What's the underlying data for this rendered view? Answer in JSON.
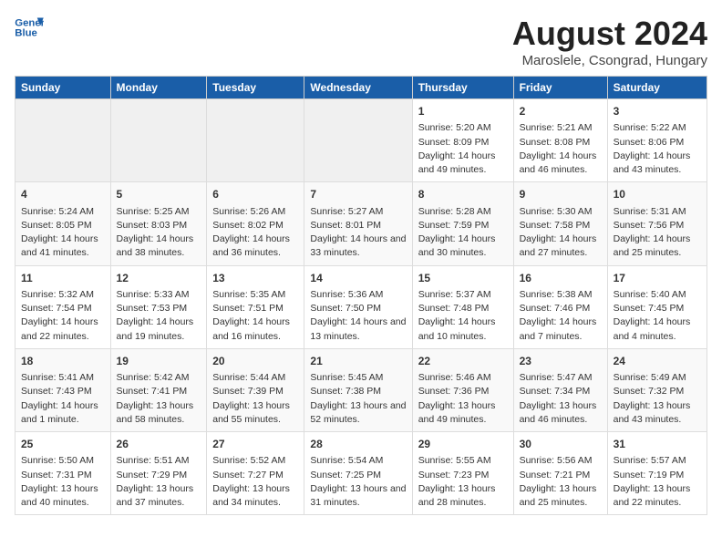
{
  "header": {
    "logo_line1": "General",
    "logo_line2": "Blue",
    "month_year": "August 2024",
    "location": "Maroslele, Csongrad, Hungary"
  },
  "days_of_week": [
    "Sunday",
    "Monday",
    "Tuesday",
    "Wednesday",
    "Thursday",
    "Friday",
    "Saturday"
  ],
  "weeks": [
    [
      {
        "day": "",
        "info": ""
      },
      {
        "day": "",
        "info": ""
      },
      {
        "day": "",
        "info": ""
      },
      {
        "day": "",
        "info": ""
      },
      {
        "day": "1",
        "info": "Sunrise: 5:20 AM\nSunset: 8:09 PM\nDaylight: 14 hours and 49 minutes."
      },
      {
        "day": "2",
        "info": "Sunrise: 5:21 AM\nSunset: 8:08 PM\nDaylight: 14 hours and 46 minutes."
      },
      {
        "day": "3",
        "info": "Sunrise: 5:22 AM\nSunset: 8:06 PM\nDaylight: 14 hours and 43 minutes."
      }
    ],
    [
      {
        "day": "4",
        "info": "Sunrise: 5:24 AM\nSunset: 8:05 PM\nDaylight: 14 hours and 41 minutes."
      },
      {
        "day": "5",
        "info": "Sunrise: 5:25 AM\nSunset: 8:03 PM\nDaylight: 14 hours and 38 minutes."
      },
      {
        "day": "6",
        "info": "Sunrise: 5:26 AM\nSunset: 8:02 PM\nDaylight: 14 hours and 36 minutes."
      },
      {
        "day": "7",
        "info": "Sunrise: 5:27 AM\nSunset: 8:01 PM\nDaylight: 14 hours and 33 minutes."
      },
      {
        "day": "8",
        "info": "Sunrise: 5:28 AM\nSunset: 7:59 PM\nDaylight: 14 hours and 30 minutes."
      },
      {
        "day": "9",
        "info": "Sunrise: 5:30 AM\nSunset: 7:58 PM\nDaylight: 14 hours and 27 minutes."
      },
      {
        "day": "10",
        "info": "Sunrise: 5:31 AM\nSunset: 7:56 PM\nDaylight: 14 hours and 25 minutes."
      }
    ],
    [
      {
        "day": "11",
        "info": "Sunrise: 5:32 AM\nSunset: 7:54 PM\nDaylight: 14 hours and 22 minutes."
      },
      {
        "day": "12",
        "info": "Sunrise: 5:33 AM\nSunset: 7:53 PM\nDaylight: 14 hours and 19 minutes."
      },
      {
        "day": "13",
        "info": "Sunrise: 5:35 AM\nSunset: 7:51 PM\nDaylight: 14 hours and 16 minutes."
      },
      {
        "day": "14",
        "info": "Sunrise: 5:36 AM\nSunset: 7:50 PM\nDaylight: 14 hours and 13 minutes."
      },
      {
        "day": "15",
        "info": "Sunrise: 5:37 AM\nSunset: 7:48 PM\nDaylight: 14 hours and 10 minutes."
      },
      {
        "day": "16",
        "info": "Sunrise: 5:38 AM\nSunset: 7:46 PM\nDaylight: 14 hours and 7 minutes."
      },
      {
        "day": "17",
        "info": "Sunrise: 5:40 AM\nSunset: 7:45 PM\nDaylight: 14 hours and 4 minutes."
      }
    ],
    [
      {
        "day": "18",
        "info": "Sunrise: 5:41 AM\nSunset: 7:43 PM\nDaylight: 14 hours and 1 minute."
      },
      {
        "day": "19",
        "info": "Sunrise: 5:42 AM\nSunset: 7:41 PM\nDaylight: 13 hours and 58 minutes."
      },
      {
        "day": "20",
        "info": "Sunrise: 5:44 AM\nSunset: 7:39 PM\nDaylight: 13 hours and 55 minutes."
      },
      {
        "day": "21",
        "info": "Sunrise: 5:45 AM\nSunset: 7:38 PM\nDaylight: 13 hours and 52 minutes."
      },
      {
        "day": "22",
        "info": "Sunrise: 5:46 AM\nSunset: 7:36 PM\nDaylight: 13 hours and 49 minutes."
      },
      {
        "day": "23",
        "info": "Sunrise: 5:47 AM\nSunset: 7:34 PM\nDaylight: 13 hours and 46 minutes."
      },
      {
        "day": "24",
        "info": "Sunrise: 5:49 AM\nSunset: 7:32 PM\nDaylight: 13 hours and 43 minutes."
      }
    ],
    [
      {
        "day": "25",
        "info": "Sunrise: 5:50 AM\nSunset: 7:31 PM\nDaylight: 13 hours and 40 minutes."
      },
      {
        "day": "26",
        "info": "Sunrise: 5:51 AM\nSunset: 7:29 PM\nDaylight: 13 hours and 37 minutes."
      },
      {
        "day": "27",
        "info": "Sunrise: 5:52 AM\nSunset: 7:27 PM\nDaylight: 13 hours and 34 minutes."
      },
      {
        "day": "28",
        "info": "Sunrise: 5:54 AM\nSunset: 7:25 PM\nDaylight: 13 hours and 31 minutes."
      },
      {
        "day": "29",
        "info": "Sunrise: 5:55 AM\nSunset: 7:23 PM\nDaylight: 13 hours and 28 minutes."
      },
      {
        "day": "30",
        "info": "Sunrise: 5:56 AM\nSunset: 7:21 PM\nDaylight: 13 hours and 25 minutes."
      },
      {
        "day": "31",
        "info": "Sunrise: 5:57 AM\nSunset: 7:19 PM\nDaylight: 13 hours and 22 minutes."
      }
    ]
  ]
}
